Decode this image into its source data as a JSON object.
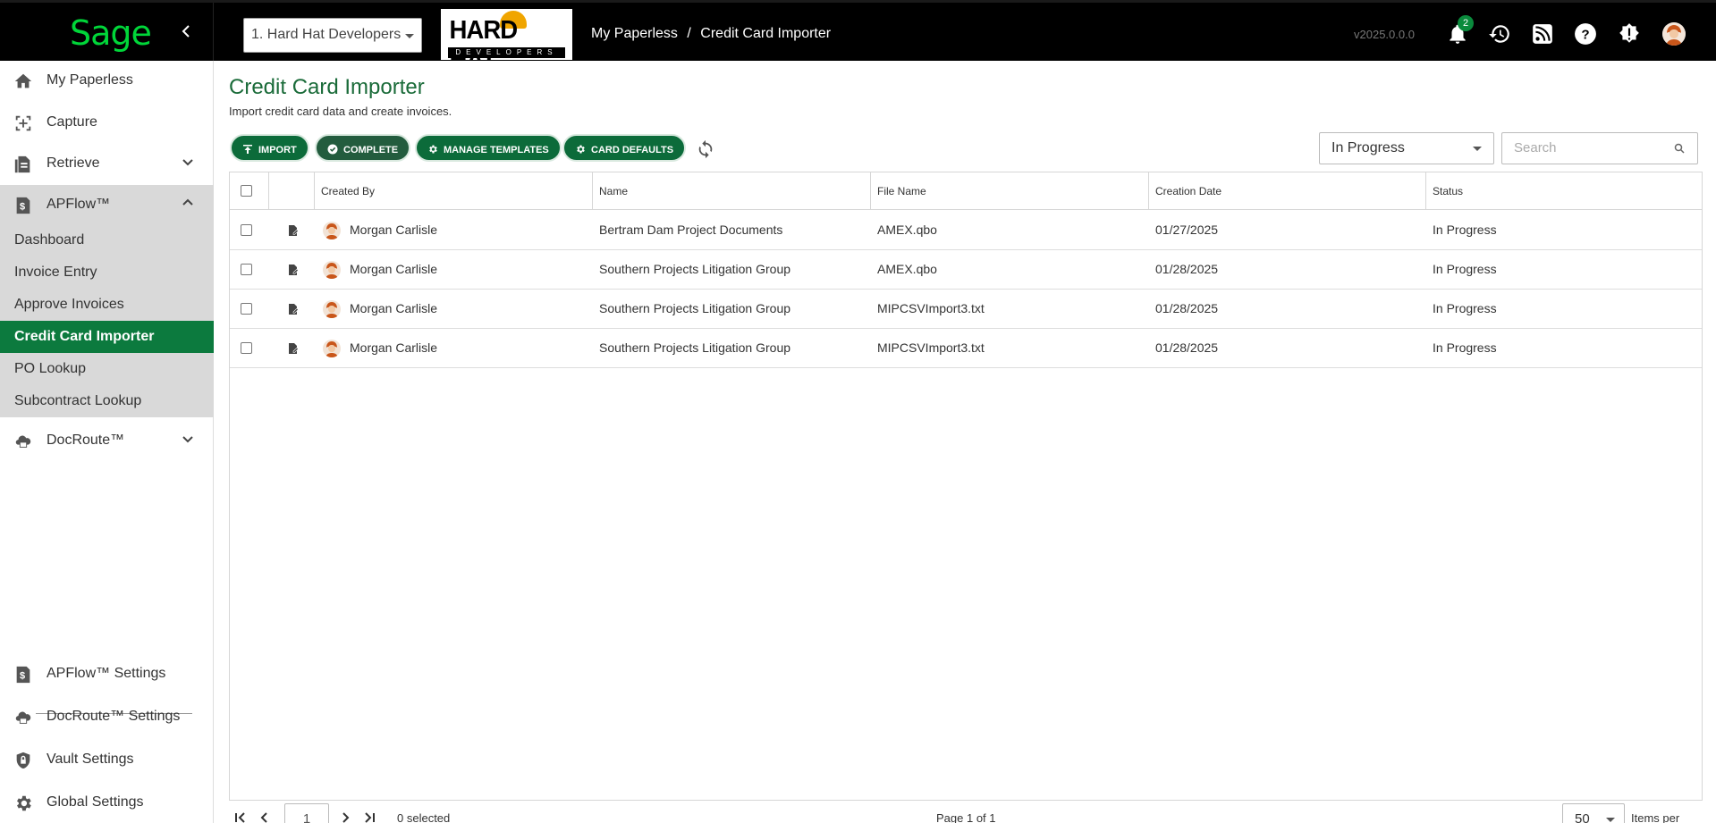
{
  "header": {
    "brand": "Sage",
    "company_select": "1. Hard Hat Developers",
    "company_logo_text": "HARD HAT",
    "company_logo_sub": "DEVELOPERS",
    "breadcrumb": [
      "My Paperless",
      "/",
      "Credit Card Importer"
    ],
    "version": "v2025.0.0.0",
    "notification_count": "2",
    "icons": [
      "bell-icon",
      "history-icon",
      "rss-icon",
      "help-icon",
      "alert-icon",
      "user-avatar"
    ]
  },
  "sidebar": {
    "items": [
      {
        "label": "My Paperless",
        "icon": "home-icon"
      },
      {
        "label": "Capture",
        "icon": "capture-icon"
      },
      {
        "label": "Retrieve",
        "icon": "retrieve-icon"
      },
      {
        "label": "APFlow™",
        "icon": "dollar-doc-icon"
      },
      {
        "label": "DocRoute™",
        "icon": "cloud-printer-icon"
      }
    ],
    "apflow_sub": [
      {
        "label": "Dashboard"
      },
      {
        "label": "Invoice Entry"
      },
      {
        "label": "Approve Invoices"
      },
      {
        "label": "Credit Card Importer"
      },
      {
        "label": "PO Lookup"
      },
      {
        "label": "Subcontract Lookup"
      }
    ],
    "settings": [
      {
        "label": "APFlow™ Settings",
        "icon": "dollar-doc-icon"
      },
      {
        "label": "DocRoute™ Settings",
        "icon": "cloud-printer-icon"
      },
      {
        "label": "Vault Settings",
        "icon": "shield-lock-icon"
      },
      {
        "label": "Global Settings",
        "icon": "gear-icon"
      }
    ]
  },
  "page": {
    "title": "Credit Card Importer",
    "subtitle": "Import credit card data and create invoices.",
    "buttons": {
      "import": "IMPORT",
      "complete": "COMPLETE",
      "manage_templates": "MANAGE TEMPLATES",
      "card_defaults": "CARD DEFAULTS"
    },
    "status_filter": "In Progress",
    "search_placeholder": "Search"
  },
  "table": {
    "columns": [
      "Created By",
      "Name",
      "File Name",
      "Creation Date",
      "Status"
    ],
    "rows": [
      {
        "created_by": "Morgan Carlisle",
        "name": "Bertram Dam Project Documents",
        "file_name": "AMEX.qbo",
        "creation_date": "01/27/2025",
        "status": "In Progress"
      },
      {
        "created_by": "Morgan Carlisle",
        "name": "Southern Projects Litigation Group",
        "file_name": "AMEX.qbo",
        "creation_date": "01/28/2025",
        "status": "In Progress"
      },
      {
        "created_by": "Morgan Carlisle",
        "name": "Southern Projects Litigation Group",
        "file_name": "MIPCSVImport3.txt",
        "creation_date": "01/28/2025",
        "status": "In Progress"
      },
      {
        "created_by": "Morgan Carlisle",
        "name": "Southern Projects Litigation Group",
        "file_name": "MIPCSVImport3.txt",
        "creation_date": "01/28/2025",
        "status": "In Progress"
      }
    ]
  },
  "pager": {
    "page_input": "1",
    "selected": "0 selected",
    "page_info": "Page 1 of 1",
    "per_page": "50",
    "per_page_label": "Items per page"
  },
  "colors": {
    "accent": "#0c7a3e",
    "topbar": "#000000",
    "sidebar_group": "#d9d9d9"
  }
}
